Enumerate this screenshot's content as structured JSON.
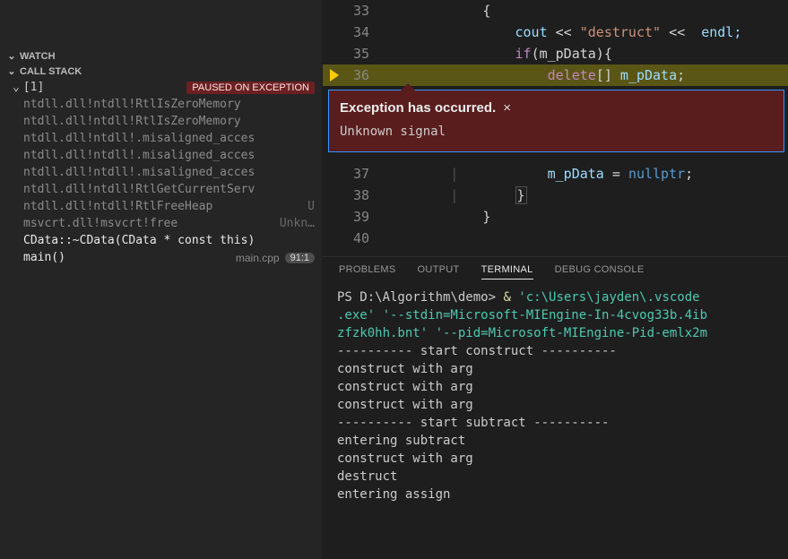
{
  "sidebar": {
    "watch_label": "WATCH",
    "callstack_label": "CALL STACK",
    "thread_label": "[1]",
    "paused_badge": "PAUSED ON EXCEPTION",
    "frames": [
      {
        "name": "ntdll.dll!ntdll!RtlIsZeroMemory"
      },
      {
        "name": "ntdll.dll!ntdll!RtlIsZeroMemory"
      },
      {
        "name": "ntdll.dll!ntdll!.misaligned_acces"
      },
      {
        "name": "ntdll.dll!ntdll!.misaligned_acces"
      },
      {
        "name": "ntdll.dll!ntdll!.misaligned_acces"
      },
      {
        "name": "ntdll.dll!ntdll!RtlGetCurrentServ"
      },
      {
        "name": "ntdll.dll!ntdll!RtlFreeHeap",
        "tail": "U"
      },
      {
        "name": "msvcrt.dll!msvcrt!free",
        "tail": "Unkn…"
      },
      {
        "name": "CData::~CData(CData * const this)",
        "active": true
      },
      {
        "name": "main()",
        "active": true,
        "file": "main.cpp",
        "line": "91:1"
      }
    ]
  },
  "editor": {
    "lines": {
      "l33": "{",
      "l34a": "cout",
      "l34b": " << ",
      "l34c": "\"destruct\"",
      "l34d": " << ",
      "l34e": " endl;",
      "l35a": "if",
      "l35b": "(m_pData)",
      "l35c": "{",
      "l36a": "delete",
      "l36b": "[] ",
      "l36c": "m_pData",
      "l36d": ";",
      "l37a": "m_pData",
      "l37b": " = ",
      "l37c": "nullptr",
      "l37d": ";",
      "l38": "}",
      "l39": "}",
      "l40": ""
    },
    "linenums": {
      "n33": "33",
      "n34": "34",
      "n35": "35",
      "n36": "36",
      "n37": "37",
      "n38": "38",
      "n39": "39",
      "n40": "40"
    }
  },
  "exception": {
    "title": "Exception has occurred.",
    "message": "Unknown signal"
  },
  "panel": {
    "tabs": {
      "problems": "PROBLEMS",
      "output": "OUTPUT",
      "terminal": "TERMINAL",
      "debug": "DEBUG CONSOLE"
    }
  },
  "terminal": {
    "prompt": "PS D:\\Algorithm\\demo> ",
    "amp": "& ",
    "cmd1": "'c:\\Users\\jayden\\.vscode",
    "cmd2": ".exe' '--stdin=Microsoft-MIEngine-In-4cvog33b.4ib",
    "cmd3": "zfzk0hh.bnt' '--pid=Microsoft-MIEngine-Pid-emlx2m",
    "out": [
      "---------- start construct ----------",
      "construct with arg",
      "construct with arg",
      "construct with arg",
      "---------- start subtract ----------",
      "entering subtract",
      "construct with arg",
      "destruct",
      "entering assign"
    ]
  }
}
